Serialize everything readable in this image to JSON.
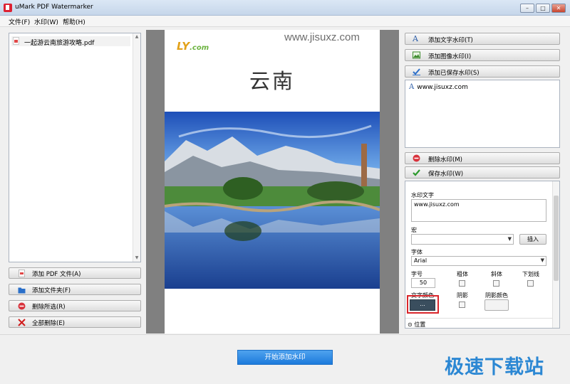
{
  "window": {
    "title": "uMark PDF Watermarker",
    "min_btn": "–",
    "max_btn": "□",
    "close_btn": "✕"
  },
  "menu": [
    "文件(F)",
    "水印(W)",
    "帮助(H)"
  ],
  "files": [
    {
      "name": "一起游云南旅游攻略.pdf"
    }
  ],
  "left_buttons": {
    "add_pdf": "添加 PDF 文件(A)",
    "add_folder": "添加文件夹(F)",
    "delete_selected": "删除所选(R)",
    "delete_all": "全部删除(E)"
  },
  "preview": {
    "logo_text": "LY",
    "logo_suffix": ".com",
    "watermark_text": "www.jisuxz.com",
    "page_title": "云南"
  },
  "right_buttons": {
    "add_text": "添加文字水印(T)",
    "add_image": "添加图像水印(I)",
    "add_saved": "添加已保存水印(S)",
    "delete_wm": "删除水印(M)",
    "save_wm": "保存水印(W)"
  },
  "watermark_list": [
    {
      "text": "www.jisuxz.com"
    }
  ],
  "props": {
    "text_label": "水印文字",
    "text_value": "www.jisuxz.com",
    "macro_label": "宏",
    "macro_value": "",
    "insert_btn": "插入",
    "font_label": "字体",
    "font_value": "Arial",
    "size_label": "字号",
    "size_value": "50",
    "bold_label": "粗体",
    "italic_label": "斜体",
    "underline_label": "下划线",
    "color_label": "文字颜色",
    "color_btn": "...",
    "shadow_label": "阴影",
    "shadow_color_label": "阴影颜色",
    "position_label": "位置",
    "colors": {
      "text_color": "#3a4e5e"
    }
  },
  "start_button": "开始添加水印",
  "brand_watermark": "极速下载站"
}
